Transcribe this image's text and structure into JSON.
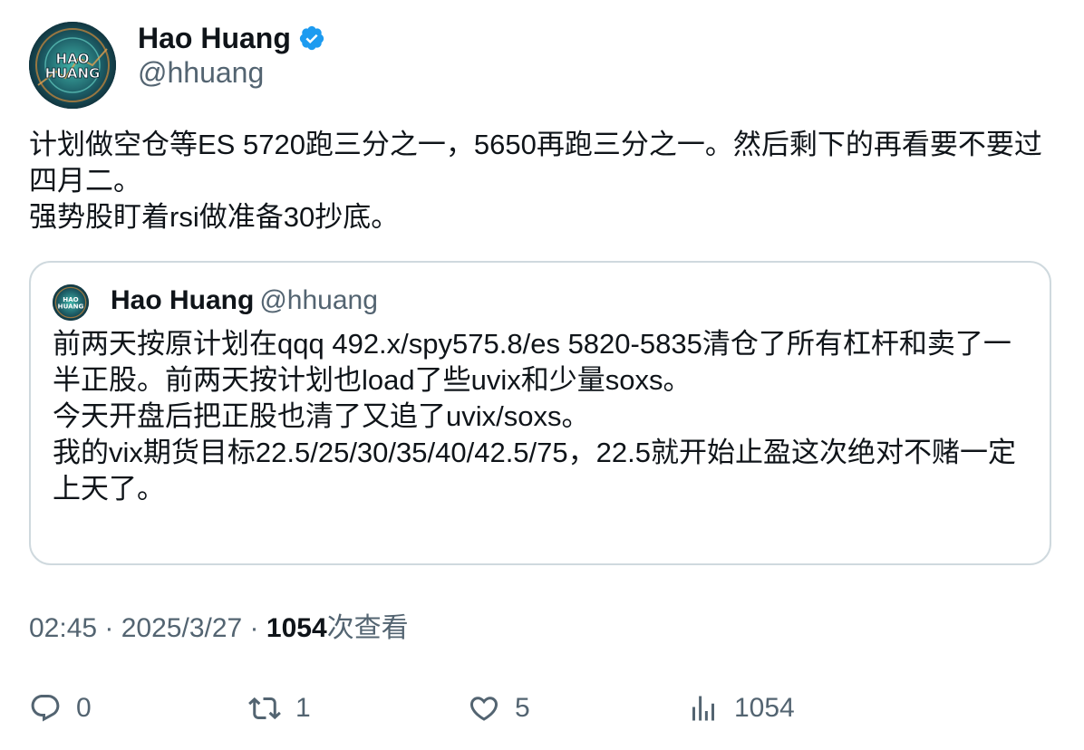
{
  "author": {
    "name": "Hao Huang",
    "handle": "@hhuang",
    "avatar_text": "HAO\nHUANG"
  },
  "tweet": {
    "text": "计划做空仓等ES 5720跑三分之一，5650再跑三分之一。然后剩下的再看要不要过四月二。\n强势股盯着rsi做准备30抄底。"
  },
  "quote": {
    "name": "Hao Huang",
    "handle": "@hhuang",
    "text": "前两天按原计划在qqq 492.x/spy575.8/es 5820-5835清仓了所有杠杆和卖了一半正股。前两天按计划也load了些uvix和少量soxs。\n今天开盘后把正股也清了又追了uvix/soxs。\n我的vix期货目标22.5/25/30/35/40/42.5/75，22.5就开始止盈这次绝对不赌一定上天了。"
  },
  "meta": {
    "time": "02:45",
    "sep1": " · ",
    "date": "2025/3/27",
    "sep2": " · ",
    "views": "1054",
    "views_label": "次查看"
  },
  "actions": {
    "replies": "0",
    "retweets": "1",
    "likes": "5",
    "views": "1054"
  },
  "colors": {
    "text": "#0f1419",
    "secondary": "#536471",
    "border": "#cfd9de",
    "verified": "#1d9bf0"
  }
}
